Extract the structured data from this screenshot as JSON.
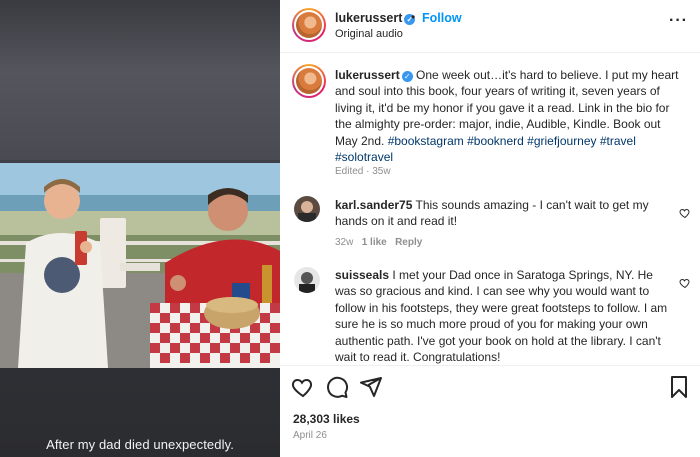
{
  "media": {
    "overlay_caption": "After my dad died unexpectedly."
  },
  "header": {
    "username": "lukerussert",
    "separator": "•",
    "follow_label": "Follow",
    "subtitle": "Original audio",
    "more_icon": "more-horizontal-icon"
  },
  "post": {
    "author": "lukerussert",
    "caption": "One week out…it's hard to believe. I put my heart and soul into this book, four years of writing it, seven years of living it, it'd be my honor if you gave it a read. Link in the bio for the almighty pre-order: major, indie, Audible, Kindle. Book out May 2nd.",
    "hashtags": [
      "#bookstagram",
      "#booknerd",
      "#griefjourney",
      "#travel",
      "#solotravel"
    ],
    "edited": "Edited",
    "time": "35w"
  },
  "comments": [
    {
      "username": "karl.sander75",
      "text": "This sounds amazing - I can't wait to get my hands on it and read it!",
      "time": "32w",
      "likes": "1 like",
      "reply_label": "Reply"
    },
    {
      "username": "suisseals",
      "text": "I met your Dad once in Saratoga Springs, NY. He was so gracious and kind. I can see why you would want to follow in his footsteps, they were great footsteps to follow. I am sure he is so much more proud of you for making your own authentic path. I've got your book on hold at the library. I can't wait to read it. Congratulations!"
    }
  ],
  "footer": {
    "likes": "28,303 likes",
    "date": "April 26"
  },
  "colors": {
    "accent": "#0095f6",
    "hashtag": "#00376b",
    "muted": "#8e8e8e",
    "text": "#262626"
  }
}
